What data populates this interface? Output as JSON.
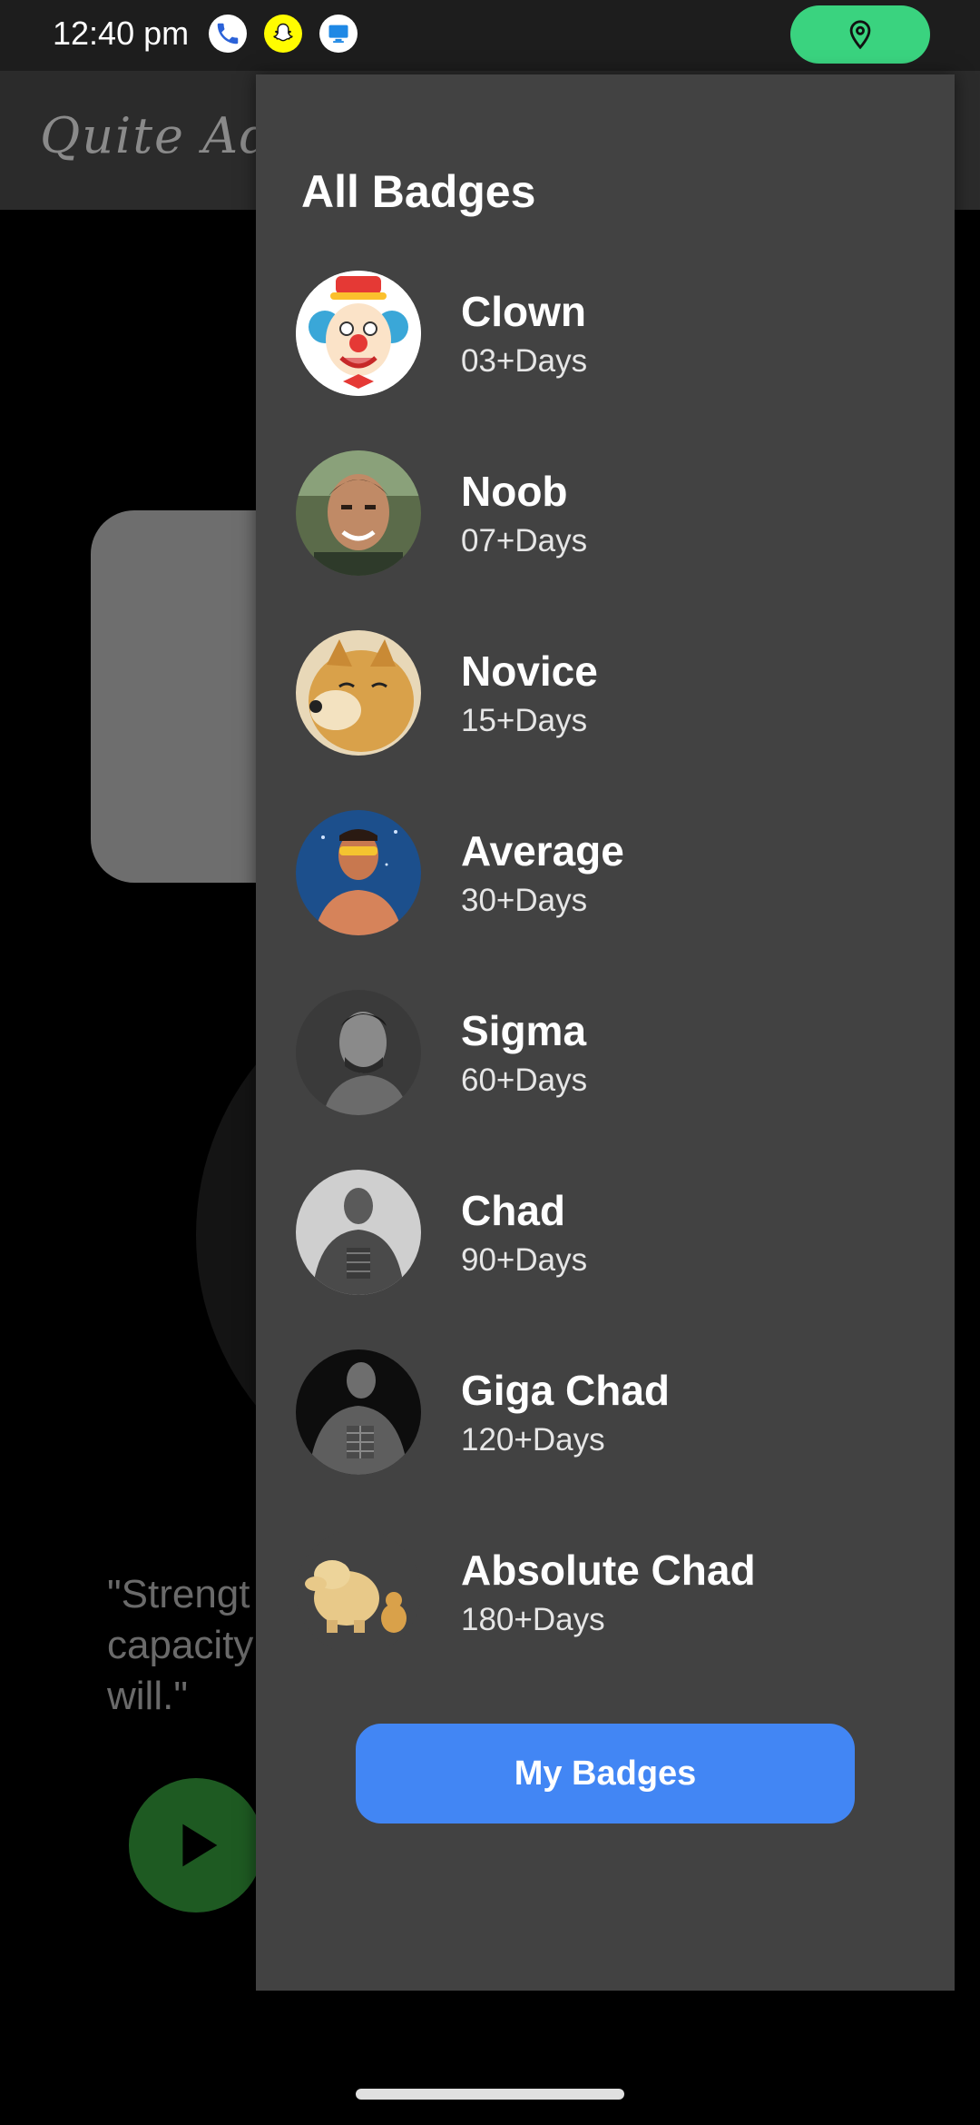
{
  "status_bar": {
    "time": "12:40 pm",
    "icons": [
      "phone-icon",
      "snapchat-icon",
      "monitor-icon",
      "location-icon"
    ],
    "location_pill_color": "#3ad37f"
  },
  "background": {
    "app_title": "Quite Addicti",
    "quote": "\"Strengt\ncapacity\nwill.\""
  },
  "drawer": {
    "title": "All Badges",
    "badges": [
      {
        "name": "Clown",
        "days": "03+Days",
        "icon": "clown-avatar"
      },
      {
        "name": "Noob",
        "days": "07+Days",
        "icon": "noob-avatar"
      },
      {
        "name": "Novice",
        "days": "15+Days",
        "icon": "doge-avatar"
      },
      {
        "name": "Average",
        "days": "30+Days",
        "icon": "average-avatar"
      },
      {
        "name": "Sigma",
        "days": "60+Days",
        "icon": "sigma-avatar"
      },
      {
        "name": "Chad",
        "days": "90+Days",
        "icon": "chad-avatar"
      },
      {
        "name": "Giga Chad",
        "days": "120+Days",
        "icon": "giga-chad-avatar"
      },
      {
        "name": "Absolute Chad",
        "days": "180+Days",
        "icon": "absolute-chad-avatar"
      }
    ],
    "button_label": "My Badges",
    "accent_color": "#4286f4"
  }
}
